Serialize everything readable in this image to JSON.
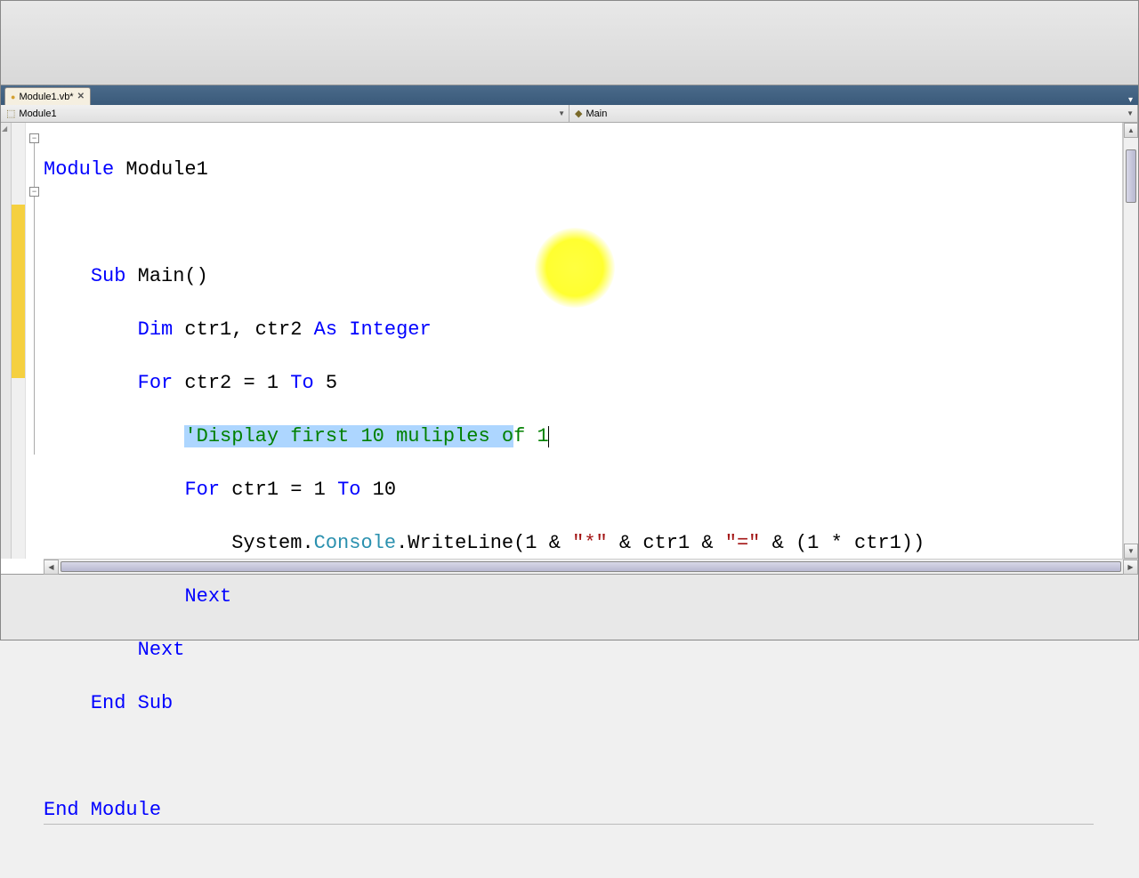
{
  "tab": {
    "filename": "Module1.vb*",
    "close_glyph": "✕"
  },
  "nav": {
    "left": "Module1",
    "right": "Main",
    "left_icon": "⬚",
    "right_icon": "◆"
  },
  "code": {
    "l1_kw": "Module",
    "l1_name": " Module1",
    "l2_kw": "Sub",
    "l2_name": " Main()",
    "l3_kw_dim": "Dim",
    "l3_vars": " ctr1, ctr2 ",
    "l3_kw_as": "As",
    "l3_sp": " ",
    "l3_type": "Integer",
    "l4_kw_for": "For",
    "l4_rest": " ctr2 = 1 ",
    "l4_kw_to": "To",
    "l4_end": " 5",
    "l5_comment_sel": "'Display first 10 muliples o",
    "l5_comment_rest": "f 1",
    "l6_kw_for": "For",
    "l6_rest": " ctr1 = 1 ",
    "l6_kw_to": "To",
    "l6_end": " 10",
    "l7_a": "System.",
    "l7_console": "Console",
    "l7_b": ".WriteLine(1 & ",
    "l7_s1": "\"*\"",
    "l7_c": " & ctr1 & ",
    "l7_s2": "\"=\"",
    "l7_d": " & (1 * ctr1))",
    "l8_next": "Next",
    "l9_next": "Next",
    "l10_end_sub": "End Sub",
    "l11_end_mod": "End Module"
  },
  "scroll": {
    "up": "▲",
    "down": "▼",
    "left": "◀",
    "right": "▶"
  }
}
